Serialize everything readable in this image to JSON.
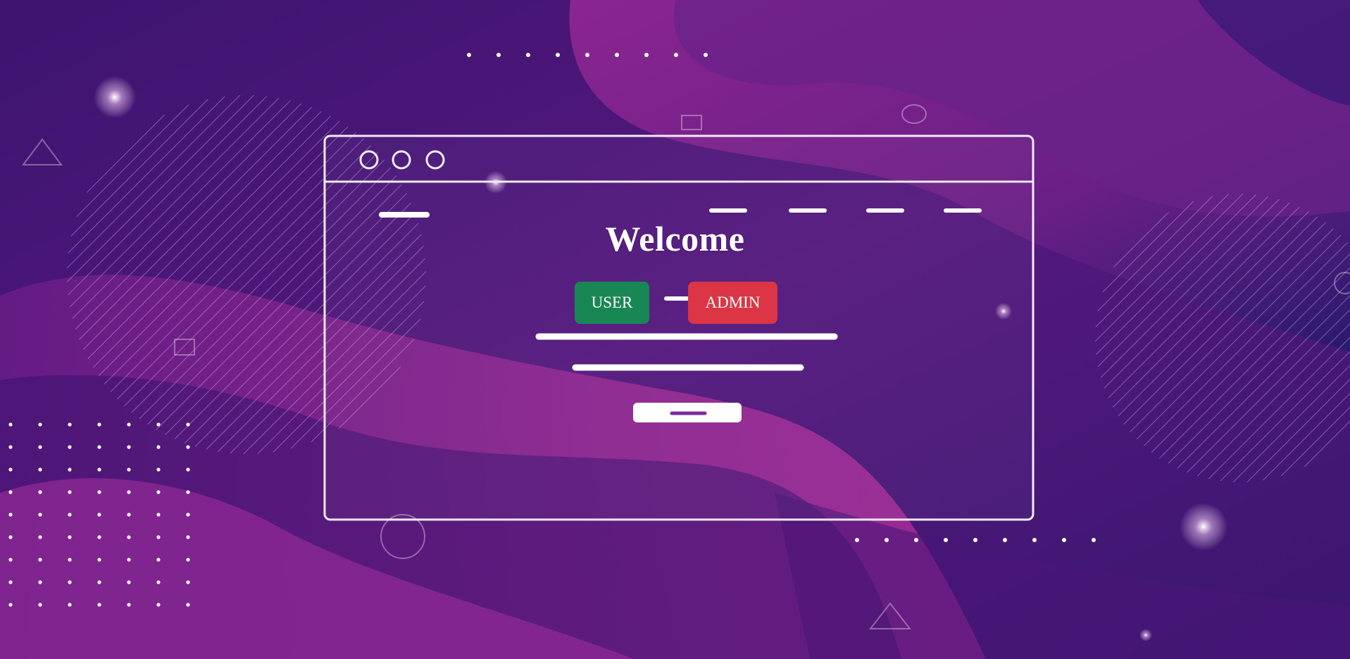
{
  "page": {
    "heading": "Welcome"
  },
  "actions": {
    "user_label": "USER",
    "user_color": "#198754",
    "admin_label": "ADMIN",
    "admin_color": "#dc3545"
  },
  "theme": {
    "background_base": "#4a1877",
    "wave_magenta": "#a22e9a",
    "wave_deep": "#2a1266",
    "line_color": "#ffffff"
  },
  "illustration": {
    "icon": "browser-window-illustration",
    "window_control_icons": [
      "circle-icon",
      "circle-icon",
      "circle-icon"
    ]
  }
}
